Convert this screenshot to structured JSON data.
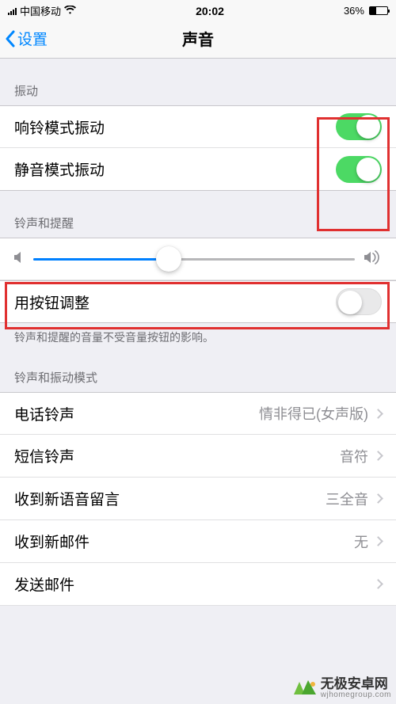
{
  "status": {
    "carrier": "中国移动",
    "time": "20:02",
    "battery_percent": "36%"
  },
  "nav": {
    "back_label": "设置",
    "title": "声音"
  },
  "sections": {
    "vibration_header": "振动",
    "ring_vibrate_label": "响铃模式振动",
    "silent_vibrate_label": "静音模式振动",
    "ringer_header": "铃声和提醒",
    "change_with_buttons_label": "用按钮调整",
    "ringer_footer": "铃声和提醒的音量不受音量按钮的影响。",
    "patterns_header": "铃声和振动模式"
  },
  "rows": {
    "ringtone": {
      "label": "电话铃声",
      "value": "情非得已(女声版)"
    },
    "text_tone": {
      "label": "短信铃声",
      "value": "音符"
    },
    "voicemail": {
      "label": "收到新语音留言",
      "value": "三全音"
    },
    "new_mail": {
      "label": "收到新邮件",
      "value": "无"
    },
    "sent_mail": {
      "label": "发送邮件",
      "value": ""
    }
  },
  "toggles": {
    "ring_vibrate_on": true,
    "silent_vibrate_on": true,
    "change_with_buttons_on": false
  },
  "slider": {
    "value_percent": 42
  },
  "watermark": {
    "title": "无极安卓网",
    "url": "wjhomegroup.com"
  }
}
